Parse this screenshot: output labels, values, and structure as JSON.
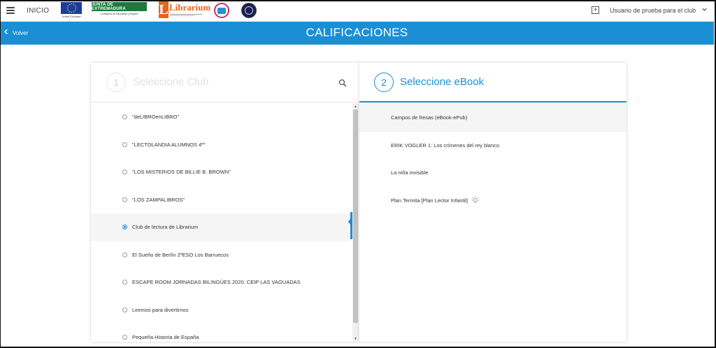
{
  "topbar": {
    "menu_icon": "hamburger-icon",
    "inicio_label": "INICIO",
    "logos": {
      "eu_caption": "Unión Europea",
      "junta_label": "JUNTA DE EXTREMADURA",
      "junta_sub": "Consejería de Educación y Empleo",
      "librarium_word": "Librarium",
      "librarium_letter": "L"
    },
    "add_icon": "plus-square-icon",
    "user_label": "Usuario de prueba para el club",
    "user_chevron": "chevron-down-icon"
  },
  "header": {
    "back_label": "Volver",
    "back_icon": "chevron-left-icon",
    "title": "CALIFICACIONES",
    "color": "#1a8fd6"
  },
  "step1": {
    "number": "1",
    "title": "Seleccione Club",
    "search_icon": "search-icon",
    "clubs": [
      {
        "label": "\"deLIBROenLIBRO\"",
        "selected": false
      },
      {
        "label": "\"LECTOLANDIA ALUMNOS 4º\"",
        "selected": false
      },
      {
        "label": "\"LOS MISTERIOS DE BILLIE B. BROWN\"",
        "selected": false
      },
      {
        "label": "\"LOS ZAMPALIBROS\"",
        "selected": false
      },
      {
        "label": "Club de lectura de Librarium",
        "selected": true
      },
      {
        "label": "El Sueño de Berlín 2ºESO Los Barruecos",
        "selected": false
      },
      {
        "label": "ESCAPE ROOM JORNADAS BILINGÜES 2020. CEIP LAS VAGUADAS",
        "selected": false
      },
      {
        "label": "Leemos para divertirnos",
        "selected": false
      },
      {
        "label": "Pequeña Historia de España",
        "selected": false
      }
    ]
  },
  "step2": {
    "number": "2",
    "title": "Seleccione eBook",
    "books": [
      {
        "label": "Campos de fresas (eBook-ePub)",
        "active": true,
        "icon": ""
      },
      {
        "label": "ERIK VOGLER 1: Los crímenes del rey blanco",
        "active": false,
        "icon": ""
      },
      {
        "label": "La niña invisible",
        "active": false,
        "icon": ""
      },
      {
        "label": "Plan Termita [Plan Lector Infantil]",
        "active": false,
        "icon": "lightbulb-icon"
      }
    ]
  }
}
